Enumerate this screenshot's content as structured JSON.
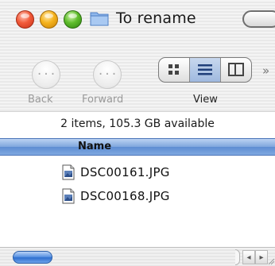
{
  "window": {
    "title": "To rename",
    "accent_color": "#5e8dd2",
    "icons": {
      "close": "close-icon",
      "minimize": "minimize-icon",
      "zoom": "zoom-icon",
      "folder": "folder-icon"
    }
  },
  "toolbar": {
    "back_label": "Back",
    "forward_label": "Forward",
    "view_label": "View",
    "back_glyph": "···",
    "forward_glyph": "···",
    "overflow_glyph": "»",
    "view_modes": [
      "icon-view",
      "list-view",
      "column-view"
    ],
    "selected_view": "list-view"
  },
  "status": {
    "text": "2 items, 105.3 GB available"
  },
  "list": {
    "column_header": "Name",
    "files": [
      {
        "name": "DSC00161.JPG",
        "icon": "jpeg-file-icon"
      },
      {
        "name": "DSC00168.JPG",
        "icon": "jpeg-file-icon"
      }
    ]
  },
  "scrollbar": {
    "left_arrow": "◂",
    "right_arrow": "▸"
  }
}
